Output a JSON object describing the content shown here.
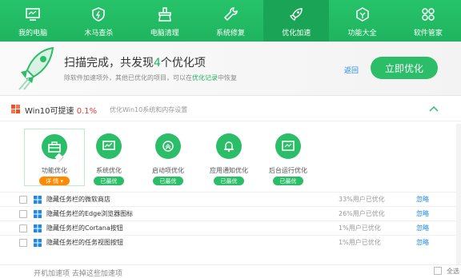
{
  "nav": [
    {
      "label": "我的电脑",
      "icon": "monitor-icon"
    },
    {
      "label": "木马查杀",
      "icon": "shield-icon"
    },
    {
      "label": "电脑清理",
      "icon": "broom-icon"
    },
    {
      "label": "系统修复",
      "icon": "wrench-icon"
    },
    {
      "label": "优化加速",
      "icon": "rocket-icon"
    },
    {
      "label": "功能大全",
      "icon": "ring-icon"
    },
    {
      "label": "软件管家",
      "icon": "grid-icon"
    }
  ],
  "banner": {
    "title_prefix": "扫描完成，共发现",
    "count": "4",
    "title_suffix": "个优化项",
    "sub_prefix": "除软件加速项外，其他已优化的项目，可以在",
    "sub_link": "优化记录",
    "sub_suffix": "中恢复",
    "back": "返回",
    "button": "立即优化"
  },
  "section": {
    "title": "Win10可提速",
    "percent": "0.1%",
    "desc": "优化Win10系统和内存设置"
  },
  "cards": [
    {
      "label": "功能优化",
      "badge": "详 情 ▾"
    },
    {
      "label": "系统优化",
      "badge": "已最优"
    },
    {
      "label": "启动项优化",
      "badge": "已最优"
    },
    {
      "label": "应用通知优化",
      "badge": "已最优"
    },
    {
      "label": "后台运行优化",
      "badge": "已最优"
    }
  ],
  "rows": [
    {
      "text": "隐藏任务栏的微软商店",
      "rate": "33%用户已优化",
      "action": "忽略"
    },
    {
      "text": "隐藏任务栏的Edge浏览器图标",
      "rate": "26%用户已优化",
      "action": "忽略"
    },
    {
      "text": "隐藏任务栏的Cortana按钮",
      "rate": "1%用户已优化",
      "action": "忽略"
    },
    {
      "text": "隐藏任务栏的任务视图按钮",
      "rate": "1%用户已优化",
      "action": "忽略"
    }
  ],
  "bottom": {
    "text": "开机加速项 去掉这些加速项",
    "check": "全选"
  },
  "colors": {
    "green": "#2bbd67",
    "orange": "#ff8a00",
    "red": "#e53935",
    "link": "#1e88e5"
  }
}
